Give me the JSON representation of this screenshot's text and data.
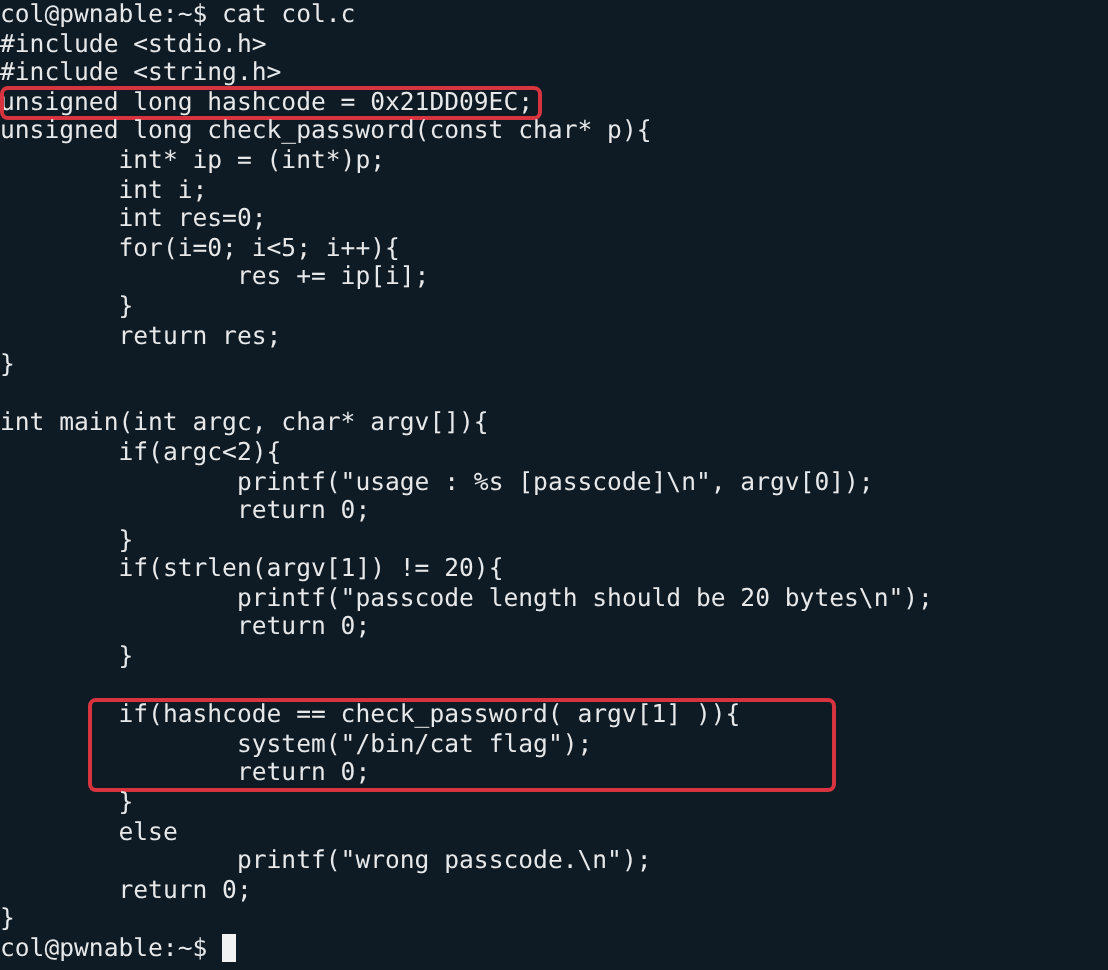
{
  "terminal": {
    "blocks": [
      {
        "kind": "code",
        "highlighted": false,
        "lines": [
          "col@pwnable:~$ cat col.c",
          "#include <stdio.h>",
          "#include <string.h>"
        ]
      },
      {
        "kind": "code",
        "highlighted": true,
        "lines": [
          "unsigned long hashcode = 0x21DD09EC;"
        ]
      },
      {
        "kind": "code",
        "highlighted": false,
        "lines": [
          "unsigned long check_password(const char* p){",
          "\tint* ip = (int*)p;",
          "\tint i;",
          "\tint res=0;",
          "\tfor(i=0; i<5; i++){",
          "\t\tres += ip[i];",
          "\t}",
          "\treturn res;",
          "}"
        ]
      },
      {
        "kind": "blank"
      },
      {
        "kind": "code",
        "highlighted": false,
        "lines": [
          "int main(int argc, char* argv[]){",
          "\tif(argc<2){",
          "\t\tprintf(\"usage : %s [passcode]\\n\", argv[0]);",
          "\t\treturn 0;",
          "\t}",
          "\tif(strlen(argv[1]) != 20){",
          "\t\tprintf(\"passcode length should be 20 bytes\\n\");",
          "\t\treturn 0;",
          "\t}"
        ]
      },
      {
        "kind": "blank"
      },
      {
        "kind": "code",
        "highlighted": true,
        "lines": [
          "\tif(hashcode == check_password( argv[1] )){",
          "\t\tsystem(\"/bin/cat flag\");",
          "\t\treturn 0;"
        ]
      },
      {
        "kind": "code",
        "highlighted": false,
        "lines": [
          "\t}",
          "\telse",
          "\t\tprintf(\"wrong passcode.\\n\");",
          "\treturn 0;",
          "}"
        ]
      }
    ],
    "prompt": "col@pwnable:~$ ",
    "cursor": true
  }
}
